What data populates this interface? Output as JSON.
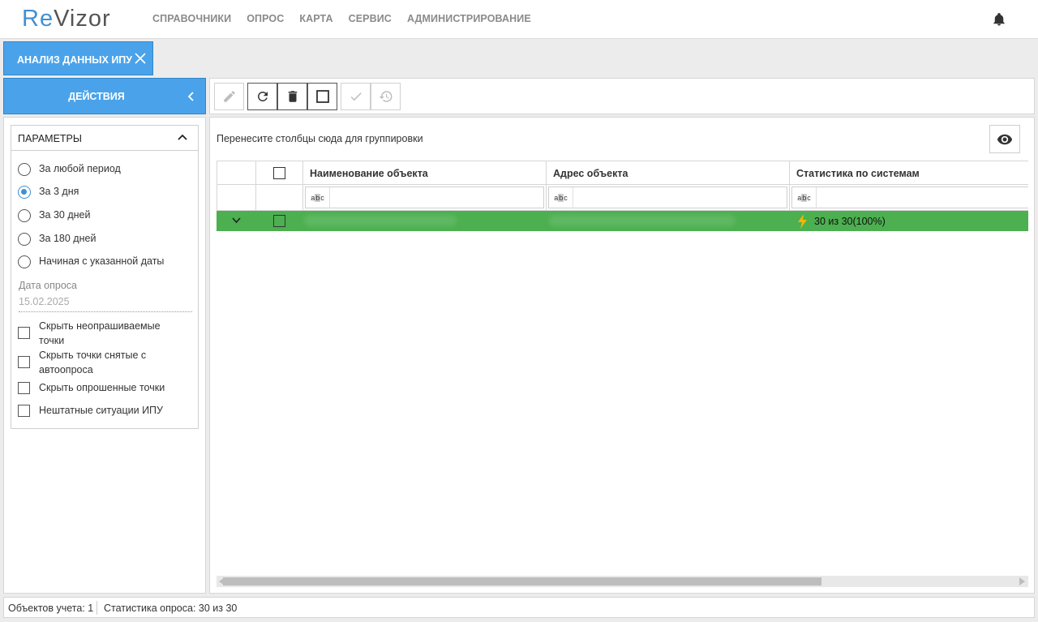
{
  "app": {
    "logo_re": "Re",
    "logo_vizor": "Vizor"
  },
  "nav": {
    "items": [
      "СПРАВОЧНИКИ",
      "ОПРОС",
      "КАРТА",
      "СЕРВИС",
      "АДМИНИСТРИРОВАНИЕ"
    ]
  },
  "header_icons": {
    "notifications": "bell-icon"
  },
  "tab": {
    "label": "АНАЛИЗ ДАННЫХ ИПУ",
    "close_icon": "close-icon"
  },
  "actions": {
    "label": "ДЕЙСТВИЯ",
    "collapse_icon": "chevron-left-icon"
  },
  "toolbar": {
    "buttons": [
      {
        "icon": "pencil-icon",
        "enabled": false
      },
      {
        "icon": "refresh-icon",
        "enabled": true
      },
      {
        "icon": "trash-icon",
        "enabled": true
      },
      {
        "icon": "square-icon",
        "enabled": true
      },
      {
        "icon": "checkmark-icon",
        "enabled": false
      },
      {
        "icon": "undo-icon",
        "enabled": false
      }
    ]
  },
  "params": {
    "title": "ПАРАМЕТРЫ",
    "period_options": [
      {
        "label": "За любой период",
        "selected": false
      },
      {
        "label": "За 3 дня",
        "selected": true
      },
      {
        "label": "За 30 дней",
        "selected": false
      },
      {
        "label": "За 180 дней",
        "selected": false
      },
      {
        "label": "Начиная с указанной даты",
        "selected": false
      }
    ],
    "date_label": "Дата опроса",
    "date_value": "15.02.2025",
    "checkboxes": [
      {
        "label": "Скрыть неопрашиваемые точки",
        "checked": false
      },
      {
        "label": "Скрыть точки снятые с автоопроса",
        "checked": false
      },
      {
        "label": "Скрыть опрошенные точки",
        "checked": false
      },
      {
        "label": "Нештатные ситуации ИПУ",
        "checked": false
      }
    ]
  },
  "grid": {
    "group_hint": "Перенесите столбцы сюда для группировки",
    "columns": [
      "Наименование объекта",
      "Адрес объекта",
      "Статистика по системам"
    ],
    "filter_icon_text": "abc",
    "rows": [
      {
        "name": "",
        "address": "",
        "stat": "30 из 30(100%)",
        "stat_icon": "lightning-icon",
        "color": "#4caf50"
      }
    ]
  },
  "status": {
    "objects": "Объектов учета: 1",
    "stats": "Статистика опроса: 30 из 30"
  },
  "colors": {
    "accent": "#4aa3ea",
    "row_ok": "#4caf50",
    "lightning": "#f2b705"
  }
}
